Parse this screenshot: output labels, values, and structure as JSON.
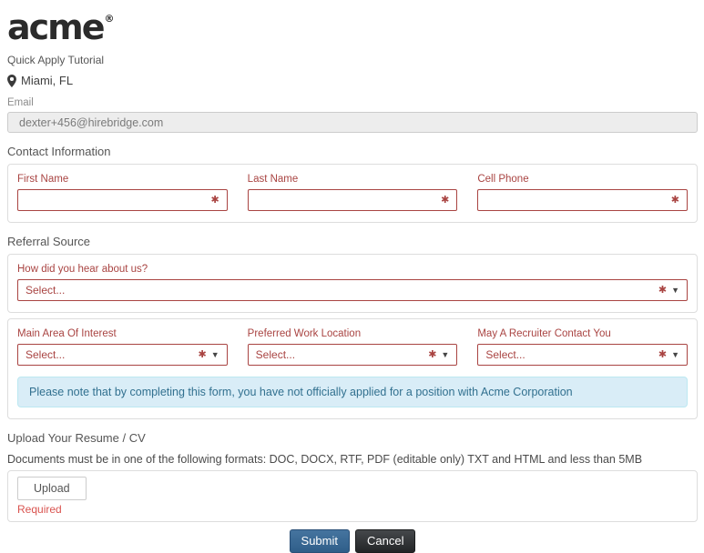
{
  "brand": {
    "logo_text": "acme",
    "registered_mark": "®"
  },
  "header": {
    "title": "Quick Apply Tutorial",
    "location": "Miami, FL"
  },
  "email": {
    "label": "Email",
    "value": "dexter+456@hirebridge.com"
  },
  "icons": {
    "required_mark": "✱",
    "dropdown_arrow": "▼"
  },
  "contact": {
    "heading": "Contact Information",
    "fields": [
      {
        "label": "First Name",
        "value": ""
      },
      {
        "label": "Last Name",
        "value": ""
      },
      {
        "label": "Cell Phone",
        "value": ""
      }
    ]
  },
  "referral": {
    "heading": "Referral Source",
    "field": {
      "label": "How did you hear about us?",
      "value": "Select..."
    }
  },
  "preferences": {
    "fields": [
      {
        "label": "Main Area Of Interest",
        "value": "Select..."
      },
      {
        "label": "Preferred Work Location",
        "value": "Select..."
      },
      {
        "label": "May A Recruiter Contact You",
        "value": "Select..."
      }
    ]
  },
  "notice": {
    "text": "Please note that by completing this form, you have not officially applied for a position with Acme Corporation"
  },
  "resume": {
    "heading": "Upload Your Resume / CV",
    "instructions": "Documents must be in one of the following formats: DOC, DOCX, RTF, PDF (editable only) TXT and HTML and less than 5MB",
    "upload_label": "Upload",
    "required_label": "Required"
  },
  "actions": {
    "submit_label": "Submit",
    "cancel_label": "Cancel"
  },
  "colors": {
    "required_red": "#a94442",
    "required_note_red": "#d9534f",
    "info_bg": "#d9edf7",
    "info_border": "#bce8f1",
    "info_text": "#31708f",
    "submit_blue": "#39689b",
    "cancel_dark": "#35383a",
    "disabled_input_bg": "#ededed"
  }
}
